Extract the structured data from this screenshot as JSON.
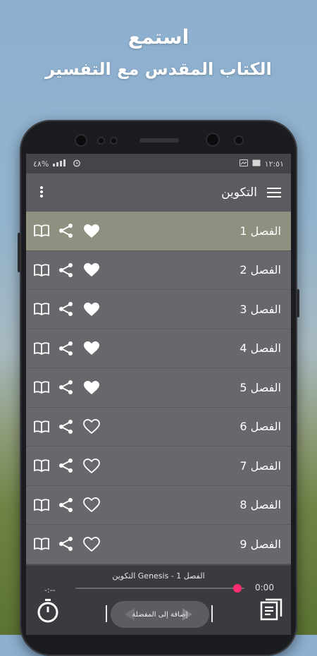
{
  "promo": {
    "line1": "استمع",
    "line2": "الكتاب المقدس مع التفسير"
  },
  "statusbar": {
    "battery": "٤٨%",
    "time": "١٢:٥١"
  },
  "appbar": {
    "title": "التكوين"
  },
  "chapters": [
    {
      "label": "الفصل 1",
      "favorite": true,
      "active": true
    },
    {
      "label": "الفصل 2",
      "favorite": true,
      "active": false
    },
    {
      "label": "الفصل 3",
      "favorite": true,
      "active": false
    },
    {
      "label": "الفصل 4",
      "favorite": true,
      "active": false
    },
    {
      "label": "الفصل 5",
      "favorite": true,
      "active": false
    },
    {
      "label": "الفصل 6",
      "favorite": false,
      "active": false
    },
    {
      "label": "الفصل 7",
      "favorite": false,
      "active": false
    },
    {
      "label": "الفصل 8",
      "favorite": false,
      "active": false
    },
    {
      "label": "الفصل 9",
      "favorite": false,
      "active": false
    }
  ],
  "player": {
    "now_playing": "التكوين Genesis - الفصل 1",
    "elapsed": "0:00",
    "remaining": "-:--",
    "progress": 0.96,
    "add_to_favorites": "إضافة إلى المفضلة"
  },
  "colors": {
    "accent": "#ff2d6f",
    "active_row": "#8f907f",
    "row": "#67686b"
  },
  "icons": {
    "row": [
      "book-open-icon",
      "share-icon",
      "heart-icon"
    ],
    "appbar": [
      "more-vert-icon",
      "menu-icon"
    ],
    "player": [
      "timer-icon",
      "playlist-icon"
    ]
  }
}
